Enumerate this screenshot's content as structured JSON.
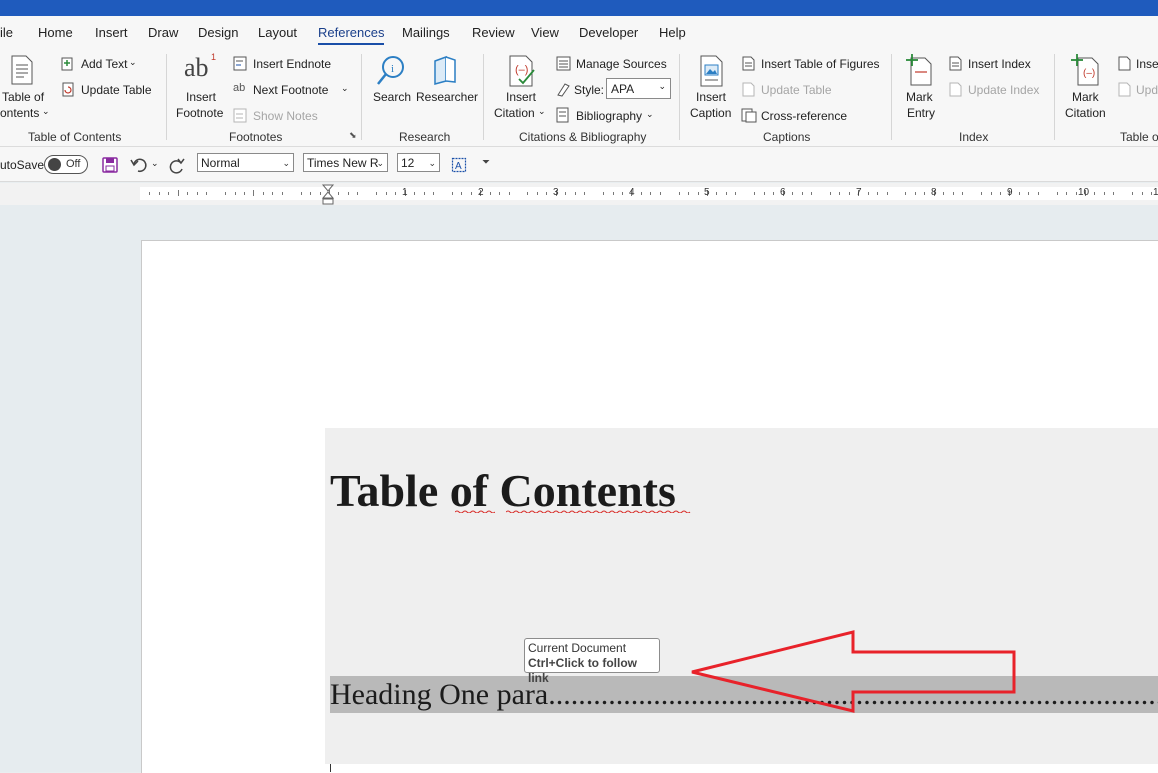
{
  "menubar": {
    "items": [
      "ile",
      "Home",
      "Insert",
      "Draw",
      "Design",
      "Layout",
      "References",
      "Mailings",
      "Review",
      "View",
      "Developer",
      "Help"
    ],
    "active": "References"
  },
  "ribbon": {
    "toc": {
      "table_of_contents_line1": "Table of",
      "table_of_contents_line2": "ontents",
      "add_text": "Add Text",
      "update_table": "Update Table",
      "group_label": "Table of Contents"
    },
    "footnotes": {
      "insert_footnote_line1": "Insert",
      "insert_footnote_line2": "Footnote",
      "insert_endnote": "Insert Endnote",
      "next_footnote": "Next Footnote",
      "show_notes": "Show Notes",
      "group_label": "Footnotes"
    },
    "research": {
      "search": "Search",
      "researcher": "Researcher",
      "group_label": "Research"
    },
    "citations": {
      "insert_citation_line1": "Insert",
      "insert_citation_line2": "Citation",
      "manage_sources": "Manage Sources",
      "style_label": "Style:",
      "style_value": "APA",
      "bibliography": "Bibliography",
      "group_label": "Citations & Bibliography"
    },
    "captions": {
      "insert_caption_line1": "Insert",
      "insert_caption_line2": "Caption",
      "insert_table_of_figures": "Insert Table of Figures",
      "update_table": "Update Table",
      "cross_reference": "Cross-reference",
      "group_label": "Captions"
    },
    "index": {
      "mark_entry_line1": "Mark",
      "mark_entry_line2": "Entry",
      "insert_index": "Insert Index",
      "update_index": "Update Index",
      "group_label": "Index"
    },
    "toa": {
      "mark_citation_line1": "Mark",
      "mark_citation_line2": "Citation",
      "insert_partial": "Inse",
      "update_partial": "Upd",
      "group_label": "Table o"
    }
  },
  "qat": {
    "autosave_label": "utoSave",
    "autosave_state": "Off",
    "style_value": "Normal",
    "font_value": "Times New R",
    "size_value": "12"
  },
  "ruler": {
    "numbers": [
      "1",
      "2",
      "3",
      "4",
      "5",
      "6",
      "7",
      "8",
      "9",
      "10",
      "1"
    ]
  },
  "document": {
    "toc_title": "Table of Contents",
    "toc_entry": "Heading One para.......................................................................................................",
    "tooltip_line1": "Current Document",
    "tooltip_line2": "Ctrl+Click to follow link"
  },
  "colors": {
    "titlebar": "#1f5bbd",
    "accent_blue": "#1a4fa8",
    "arrow_red": "#e8222a",
    "save_purple": "#8a2aa0"
  }
}
